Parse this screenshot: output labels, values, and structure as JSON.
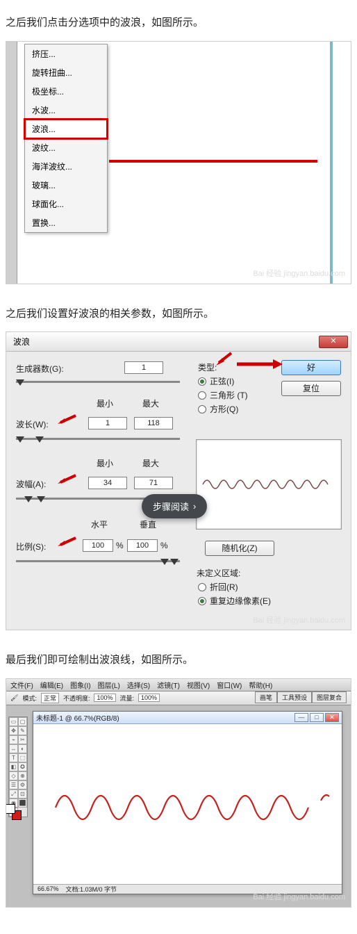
{
  "step1": {
    "caption": "之后我们点击分选项中的波浪，如图所示。",
    "menu_items": [
      "挤压...",
      "旋转扭曲...",
      "极坐标...",
      "水波...",
      "波浪...",
      "波纹...",
      "海洋波纹...",
      "玻璃...",
      "球面化...",
      "置换..."
    ],
    "highlight_index": 4,
    "watermark": "Bai 经验\njingyan.baidu.com"
  },
  "step2": {
    "caption": "之后我们设置好波浪的相关参数，如图所示。",
    "dialog_title": "波浪",
    "labels": {
      "generators": "生成器数(G):",
      "min": "最小",
      "max": "最大",
      "wavelength": "波长(W):",
      "amplitude": "波幅(A):",
      "horizontal": "水平",
      "vertical": "垂直",
      "scale": "比例(S):",
      "type": "类型:",
      "undefined": "未定义区域:",
      "percent": "%"
    },
    "values": {
      "generators": "1",
      "wl_min": "1",
      "wl_max": "118",
      "amp_min": "34",
      "amp_max": "71",
      "scale_h": "100",
      "scale_v": "100"
    },
    "type_options": {
      "sine": "正弦(I)",
      "triangle": "三角形 (T)",
      "square": "方形(Q)"
    },
    "undefined_options": {
      "wrap": "折回(R)",
      "repeat": "重复边缘像素(E)"
    },
    "buttons": {
      "ok": "好",
      "reset": "复位",
      "randomize": "随机化(Z)"
    },
    "pill": "步骤阅读",
    "watermark": "Bai 经验\njingyan.baidu.com"
  },
  "step3": {
    "caption": "最后我们即可绘制出波浪线，如图所示。",
    "menubar": [
      "文件(F)",
      "编辑(E)",
      "图象(I)",
      "图层(L)",
      "选择(S)",
      "滤镜(T)",
      "视图(V)",
      "窗口(W)",
      "帮助(H)"
    ],
    "optbar": {
      "brush_lbl": "模式:",
      "brush_val": "正常",
      "opacity_lbl": "不透明度:",
      "opacity_val": "100%",
      "flow_lbl": "流量:",
      "flow_val": "100%"
    },
    "tabs": [
      "画笔",
      "工具预设",
      "图层复合"
    ],
    "doc_title": "未标题-1 @ 66.7%(RGB/8)",
    "status": {
      "zoom": "66.67%",
      "doc": "文档:1.03M/0 字节"
    },
    "watermark": "Bai 经验\njingyan.baidu.com"
  }
}
